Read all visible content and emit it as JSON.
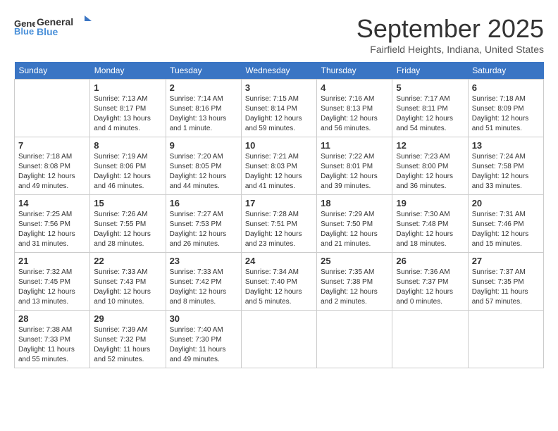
{
  "header": {
    "logo_line1": "General",
    "logo_line2": "Blue",
    "month_title": "September 2025",
    "location": "Fairfield Heights, Indiana, United States"
  },
  "weekdays": [
    "Sunday",
    "Monday",
    "Tuesday",
    "Wednesday",
    "Thursday",
    "Friday",
    "Saturday"
  ],
  "weeks": [
    [
      {
        "day": "",
        "sunrise": "",
        "sunset": "",
        "daylight": ""
      },
      {
        "day": "1",
        "sunrise": "Sunrise: 7:13 AM",
        "sunset": "Sunset: 8:17 PM",
        "daylight": "Daylight: 13 hours and 4 minutes."
      },
      {
        "day": "2",
        "sunrise": "Sunrise: 7:14 AM",
        "sunset": "Sunset: 8:16 PM",
        "daylight": "Daylight: 13 hours and 1 minute."
      },
      {
        "day": "3",
        "sunrise": "Sunrise: 7:15 AM",
        "sunset": "Sunset: 8:14 PM",
        "daylight": "Daylight: 12 hours and 59 minutes."
      },
      {
        "day": "4",
        "sunrise": "Sunrise: 7:16 AM",
        "sunset": "Sunset: 8:13 PM",
        "daylight": "Daylight: 12 hours and 56 minutes."
      },
      {
        "day": "5",
        "sunrise": "Sunrise: 7:17 AM",
        "sunset": "Sunset: 8:11 PM",
        "daylight": "Daylight: 12 hours and 54 minutes."
      },
      {
        "day": "6",
        "sunrise": "Sunrise: 7:18 AM",
        "sunset": "Sunset: 8:09 PM",
        "daylight": "Daylight: 12 hours and 51 minutes."
      }
    ],
    [
      {
        "day": "7",
        "sunrise": "Sunrise: 7:18 AM",
        "sunset": "Sunset: 8:08 PM",
        "daylight": "Daylight: 12 hours and 49 minutes."
      },
      {
        "day": "8",
        "sunrise": "Sunrise: 7:19 AM",
        "sunset": "Sunset: 8:06 PM",
        "daylight": "Daylight: 12 hours and 46 minutes."
      },
      {
        "day": "9",
        "sunrise": "Sunrise: 7:20 AM",
        "sunset": "Sunset: 8:05 PM",
        "daylight": "Daylight: 12 hours and 44 minutes."
      },
      {
        "day": "10",
        "sunrise": "Sunrise: 7:21 AM",
        "sunset": "Sunset: 8:03 PM",
        "daylight": "Daylight: 12 hours and 41 minutes."
      },
      {
        "day": "11",
        "sunrise": "Sunrise: 7:22 AM",
        "sunset": "Sunset: 8:01 PM",
        "daylight": "Daylight: 12 hours and 39 minutes."
      },
      {
        "day": "12",
        "sunrise": "Sunrise: 7:23 AM",
        "sunset": "Sunset: 8:00 PM",
        "daylight": "Daylight: 12 hours and 36 minutes."
      },
      {
        "day": "13",
        "sunrise": "Sunrise: 7:24 AM",
        "sunset": "Sunset: 7:58 PM",
        "daylight": "Daylight: 12 hours and 33 minutes."
      }
    ],
    [
      {
        "day": "14",
        "sunrise": "Sunrise: 7:25 AM",
        "sunset": "Sunset: 7:56 PM",
        "daylight": "Daylight: 12 hours and 31 minutes."
      },
      {
        "day": "15",
        "sunrise": "Sunrise: 7:26 AM",
        "sunset": "Sunset: 7:55 PM",
        "daylight": "Daylight: 12 hours and 28 minutes."
      },
      {
        "day": "16",
        "sunrise": "Sunrise: 7:27 AM",
        "sunset": "Sunset: 7:53 PM",
        "daylight": "Daylight: 12 hours and 26 minutes."
      },
      {
        "day": "17",
        "sunrise": "Sunrise: 7:28 AM",
        "sunset": "Sunset: 7:51 PM",
        "daylight": "Daylight: 12 hours and 23 minutes."
      },
      {
        "day": "18",
        "sunrise": "Sunrise: 7:29 AM",
        "sunset": "Sunset: 7:50 PM",
        "daylight": "Daylight: 12 hours and 21 minutes."
      },
      {
        "day": "19",
        "sunrise": "Sunrise: 7:30 AM",
        "sunset": "Sunset: 7:48 PM",
        "daylight": "Daylight: 12 hours and 18 minutes."
      },
      {
        "day": "20",
        "sunrise": "Sunrise: 7:31 AM",
        "sunset": "Sunset: 7:46 PM",
        "daylight": "Daylight: 12 hours and 15 minutes."
      }
    ],
    [
      {
        "day": "21",
        "sunrise": "Sunrise: 7:32 AM",
        "sunset": "Sunset: 7:45 PM",
        "daylight": "Daylight: 12 hours and 13 minutes."
      },
      {
        "day": "22",
        "sunrise": "Sunrise: 7:33 AM",
        "sunset": "Sunset: 7:43 PM",
        "daylight": "Daylight: 12 hours and 10 minutes."
      },
      {
        "day": "23",
        "sunrise": "Sunrise: 7:33 AM",
        "sunset": "Sunset: 7:42 PM",
        "daylight": "Daylight: 12 hours and 8 minutes."
      },
      {
        "day": "24",
        "sunrise": "Sunrise: 7:34 AM",
        "sunset": "Sunset: 7:40 PM",
        "daylight": "Daylight: 12 hours and 5 minutes."
      },
      {
        "day": "25",
        "sunrise": "Sunrise: 7:35 AM",
        "sunset": "Sunset: 7:38 PM",
        "daylight": "Daylight: 12 hours and 2 minutes."
      },
      {
        "day": "26",
        "sunrise": "Sunrise: 7:36 AM",
        "sunset": "Sunset: 7:37 PM",
        "daylight": "Daylight: 12 hours and 0 minutes."
      },
      {
        "day": "27",
        "sunrise": "Sunrise: 7:37 AM",
        "sunset": "Sunset: 7:35 PM",
        "daylight": "Daylight: 11 hours and 57 minutes."
      }
    ],
    [
      {
        "day": "28",
        "sunrise": "Sunrise: 7:38 AM",
        "sunset": "Sunset: 7:33 PM",
        "daylight": "Daylight: 11 hours and 55 minutes."
      },
      {
        "day": "29",
        "sunrise": "Sunrise: 7:39 AM",
        "sunset": "Sunset: 7:32 PM",
        "daylight": "Daylight: 11 hours and 52 minutes."
      },
      {
        "day": "30",
        "sunrise": "Sunrise: 7:40 AM",
        "sunset": "Sunset: 7:30 PM",
        "daylight": "Daylight: 11 hours and 49 minutes."
      },
      {
        "day": "",
        "sunrise": "",
        "sunset": "",
        "daylight": ""
      },
      {
        "day": "",
        "sunrise": "",
        "sunset": "",
        "daylight": ""
      },
      {
        "day": "",
        "sunrise": "",
        "sunset": "",
        "daylight": ""
      },
      {
        "day": "",
        "sunrise": "",
        "sunset": "",
        "daylight": ""
      }
    ]
  ]
}
